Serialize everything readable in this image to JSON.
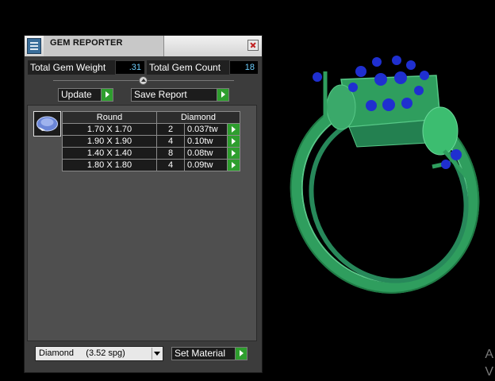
{
  "window": {
    "title": "GEM REPORTER"
  },
  "stats": {
    "total_weight_label": "Total Gem Weight",
    "total_weight_value": ".31",
    "total_count_label": "Total Gem Count",
    "total_count_value": "18"
  },
  "buttons": {
    "update": "Update",
    "save_report": "Save Report",
    "set_material": "Set Material"
  },
  "table": {
    "headers": {
      "shape": "Round",
      "material": "Diamond"
    },
    "rows": [
      {
        "size": "1.70 X 1.70",
        "count": "2",
        "weight": "0.037tw"
      },
      {
        "size": "1.90 X 1.90",
        "count": "4",
        "weight": "0.10tw"
      },
      {
        "size": "1.40 X 1.40",
        "count": "8",
        "weight": "0.08tw"
      },
      {
        "size": "1.80 X 1.80",
        "count": "4",
        "weight": "0.09tw"
      }
    ]
  },
  "material_select": {
    "value": "Diamond     (3.52 spg)"
  },
  "viewport": {
    "edge_text_1": "A",
    "edge_text_2": "V"
  },
  "colors": {
    "ring_metal": "#2f9e5e",
    "gem_blue": "#1f2fd0",
    "accent_green": "#2e9e2e",
    "value_cyan": "#6fd0ff"
  },
  "icons": {
    "app": "gem-reporter-icon",
    "close": "close-icon",
    "gem": "round-gem-icon",
    "collapse": "collapse-arrow-icon"
  }
}
